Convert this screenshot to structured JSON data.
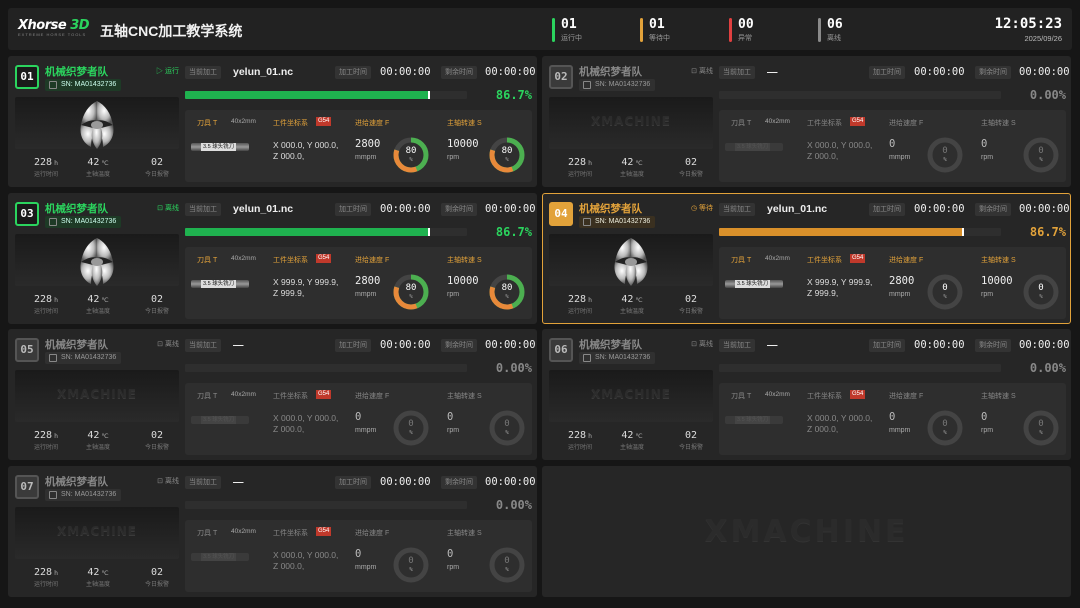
{
  "header": {
    "logo_text": "Xhorse 3D",
    "logo_sub": "EXTREME HORSE TOOLS",
    "title": "五轴CNC加工教学系统",
    "stats": [
      {
        "num": "01",
        "label": "运行中",
        "color": "#2bd45e"
      },
      {
        "num": "01",
        "label": "等待中",
        "color": "#e2a23a"
      },
      {
        "num": "00",
        "label": "异常",
        "color": "#e04040"
      },
      {
        "num": "06",
        "label": "离线",
        "color": "#8a8a8a"
      }
    ],
    "time": "12:05:23",
    "date": "2025/09/26"
  },
  "labels": {
    "current": "当前加工",
    "proc_time": "加工时间",
    "remain_time": "剩余时间",
    "tool": "刀具 T",
    "tool_size": "40x2mm",
    "wcs": "工件坐标系",
    "wcs_badge": "G54",
    "feed": "进给速度 F",
    "spindle": "主轴转速 S",
    "unit_feed": "mmpm",
    "unit_rpm": "rpm",
    "unit_pct": "%",
    "run_time": "运行时间",
    "spindle_temp": "主轴温度",
    "today_alarm": "今日报警",
    "unit_h": "h",
    "unit_c": "℃",
    "brand": "XMACHINE",
    "tool_tag": "3.5 球头铣刀"
  },
  "machines": [
    {
      "id": "01",
      "team": "机械织梦者队",
      "sn": "SN: MA01432736",
      "state": "运行",
      "status": "run",
      "file": "yelun_01.nc",
      "proc_time": "00:00:00",
      "remain_time": "00:00:00",
      "progress": 86.7,
      "pct": "86.7%",
      "x": "000.0,",
      "y": "000.0,",
      "z": "000.0,",
      "feed": "2800",
      "feed_pct": 80,
      "feed_pct_text": "80",
      "rpm": "10000",
      "rpm_pct": 80,
      "rpm_pct_text": "80",
      "hours": "228",
      "temp": "42",
      "alarms": "02"
    },
    {
      "id": "02",
      "team": "机械织梦者队",
      "sn": "SN: MA01432736",
      "state": "离线",
      "status": "off",
      "file": "—",
      "proc_time": "00:00:00",
      "remain_time": "00:00:00",
      "progress": 0,
      "pct": "0.00%",
      "x": "000.0,",
      "y": "000.0,",
      "z": "000.0,",
      "feed": "0",
      "feed_pct": 0,
      "feed_pct_text": "0",
      "rpm": "0",
      "rpm_pct": 0,
      "rpm_pct_text": "0",
      "hours": "228",
      "temp": "42",
      "alarms": "02"
    },
    {
      "id": "03",
      "team": "机械织梦者队",
      "sn": "SN: MA01432736",
      "state": "离线",
      "status": "run",
      "file": "yelun_01.nc",
      "proc_time": "00:00:00",
      "remain_time": "00:00:00",
      "progress": 86.7,
      "pct": "86.7%",
      "x": "999.9,",
      "y": "999.9,",
      "z": "999.9,",
      "feed": "2800",
      "feed_pct": 80,
      "feed_pct_text": "80",
      "rpm": "10000",
      "rpm_pct": 80,
      "rpm_pct_text": "80",
      "hours": "228",
      "temp": "42",
      "alarms": "02"
    },
    {
      "id": "04",
      "team": "机械织梦者队",
      "sn": "SN: MA01432736",
      "state": "等待",
      "status": "warn",
      "file": "yelun_01.nc",
      "proc_time": "00:00:00",
      "remain_time": "00:00:00",
      "progress": 86.7,
      "pct": "86.7%",
      "x": "999.9,",
      "y": "999.9,",
      "z": "999.9,",
      "feed": "2800",
      "feed_pct": 0,
      "feed_pct_text": "0",
      "rpm": "10000",
      "rpm_pct": 0,
      "rpm_pct_text": "0",
      "hours": "228",
      "temp": "42",
      "alarms": "02"
    },
    {
      "id": "05",
      "team": "机械织梦者队",
      "sn": "SN: MA01432736",
      "state": "离线",
      "status": "off",
      "file": "—",
      "proc_time": "00:00:00",
      "remain_time": "00:00:00",
      "progress": 0,
      "pct": "0.00%",
      "x": "000.0,",
      "y": "000.0,",
      "z": "000.0,",
      "feed": "0",
      "feed_pct": 0,
      "feed_pct_text": "0",
      "rpm": "0",
      "rpm_pct": 0,
      "rpm_pct_text": "0",
      "hours": "228",
      "temp": "42",
      "alarms": "02"
    },
    {
      "id": "06",
      "team": "机械织梦者队",
      "sn": "SN: MA01432736",
      "state": "离线",
      "status": "off",
      "file": "—",
      "proc_time": "00:00:00",
      "remain_time": "00:00:00",
      "progress": 0,
      "pct": "0.00%",
      "x": "000.0,",
      "y": "000.0,",
      "z": "000.0,",
      "feed": "0",
      "feed_pct": 0,
      "feed_pct_text": "0",
      "rpm": "0",
      "rpm_pct": 0,
      "rpm_pct_text": "0",
      "hours": "228",
      "temp": "42",
      "alarms": "02"
    },
    {
      "id": "07",
      "team": "机械织梦者队",
      "sn": "SN: MA01432736",
      "state": "离线",
      "status": "off",
      "file": "—",
      "proc_time": "00:00:00",
      "remain_time": "00:00:00",
      "progress": 0,
      "pct": "0.00%",
      "x": "000.0,",
      "y": "000.0,",
      "z": "000.0,",
      "feed": "0",
      "feed_pct": 0,
      "feed_pct_text": "0",
      "rpm": "0",
      "rpm_pct": 0,
      "rpm_pct_text": "0",
      "hours": "228",
      "temp": "42",
      "alarms": "02"
    }
  ],
  "colors": {
    "run": "#2bd45e",
    "warn": "#e2a23a",
    "offline": "#8a8a8a",
    "alarm": "#e04040"
  }
}
